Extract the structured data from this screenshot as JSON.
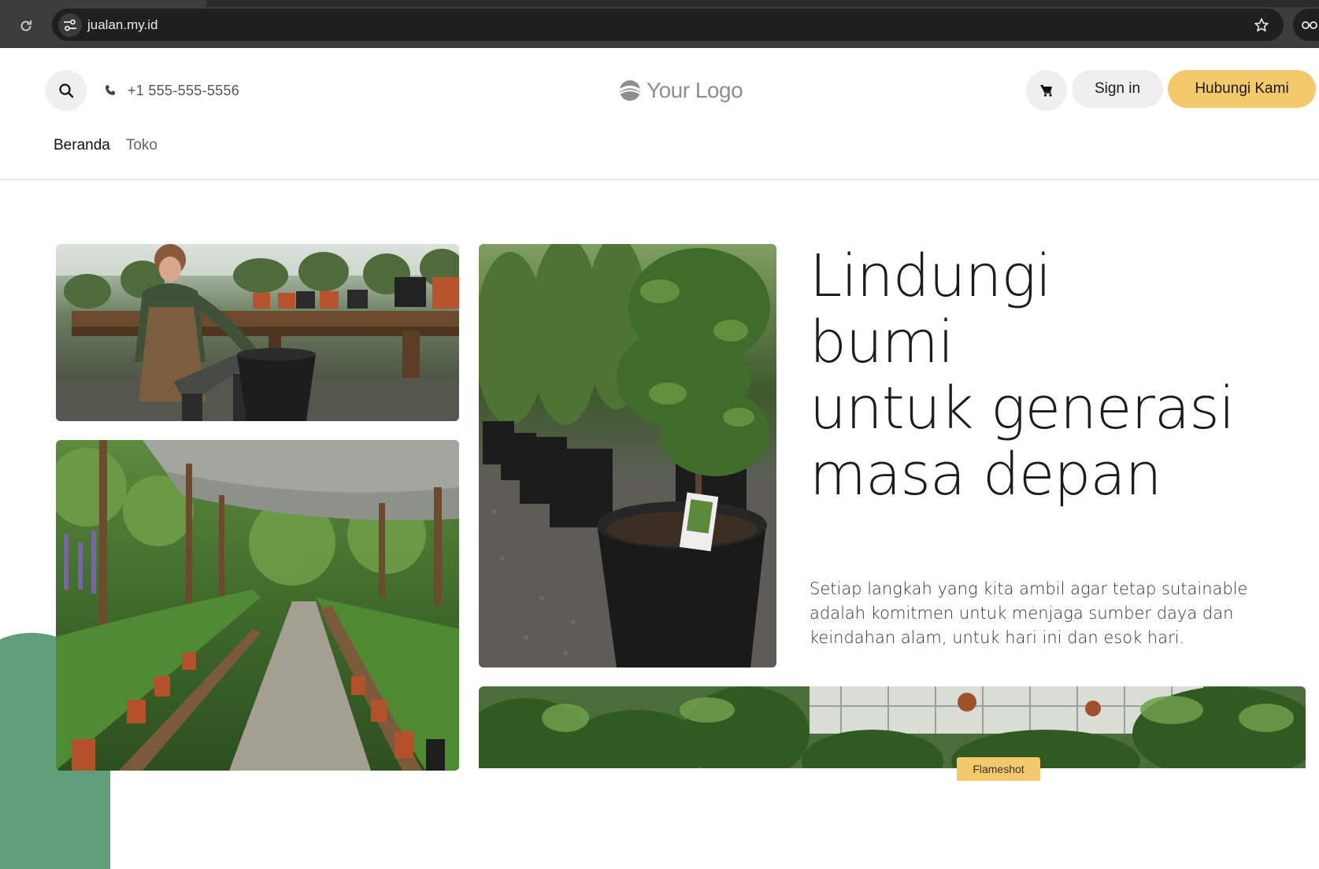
{
  "browser": {
    "url": "jualan.my.id",
    "icons": [
      "reload-icon",
      "site-info-icon",
      "star-icon",
      "extensions-icon"
    ]
  },
  "header": {
    "phone": "+1 555-555-5556",
    "logo_text": "Your Logo",
    "signin_label": "Sign in",
    "contact_label": "Hubungi Kami",
    "icons": [
      "search-icon",
      "phone-icon",
      "logo-icon",
      "cart-icon"
    ],
    "nav": [
      {
        "label": "Beranda",
        "active": true
      },
      {
        "label": "Toko",
        "active": false
      }
    ]
  },
  "hero": {
    "heading_lines": [
      "Lindungi",
      "bumi",
      "untuk generasi",
      "masa depan"
    ],
    "description": "Setiap langkah yang kita ambil agar tetap sutainable adalah komitmen untuk menjaga sumber daya dan keindahan alam, untuk hari ini dan esok hari.",
    "overlay_tag": "Flameshot"
  },
  "colors": {
    "accent": "#f3c96b",
    "green_blob": "#5f9e78",
    "chrome_bg": "#3c3c3c",
    "omnibox_bg": "#1f1f1f"
  }
}
